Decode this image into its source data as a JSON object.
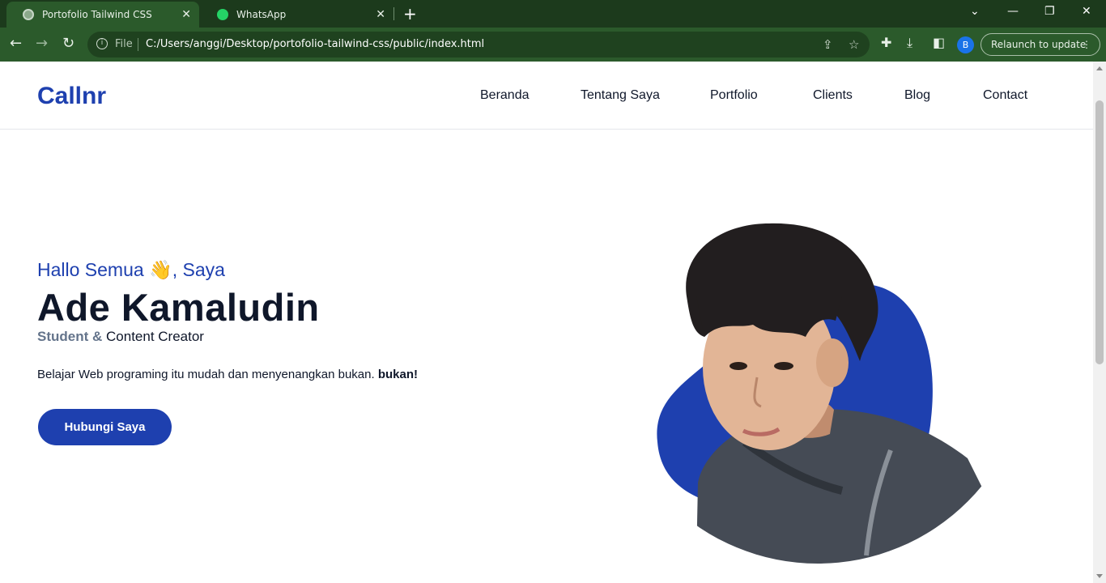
{
  "browser": {
    "tabs": [
      {
        "title": "Portofolio Tailwind CSS",
        "active": true,
        "icon": "globe-icon"
      },
      {
        "title": "WhatsApp",
        "active": false,
        "icon": "whatsapp-icon"
      }
    ],
    "address": {
      "scheme_label": "File",
      "url": "C:/Users/anggi/Desktop/portofolio-tailwind-css/public/index.html"
    },
    "profile_initial": "B",
    "relaunch_label": "Relaunch to update",
    "theme_color": "#2b5a2b"
  },
  "site": {
    "logo": "Callnr",
    "nav": [
      "Beranda",
      "Tentang Saya",
      "Portfolio",
      "Clients",
      "Blog",
      "Contact"
    ],
    "hero": {
      "greeting_prefix": "Hallo Semua",
      "greeting_emoji": "👋",
      "greeting_suffix": ", Saya",
      "name": "Ade Kamaludin",
      "role_primary": "Student &",
      "role_secondary": "Content Creator",
      "description": "Belajar Web programing itu mudah dan menyenangkan bukan.",
      "description_bold": "bukan!",
      "cta_label": "Hubungi Saya"
    },
    "colors": {
      "primary": "#1e40af",
      "dark": "#0f172a",
      "secondary": "#64748b"
    }
  }
}
